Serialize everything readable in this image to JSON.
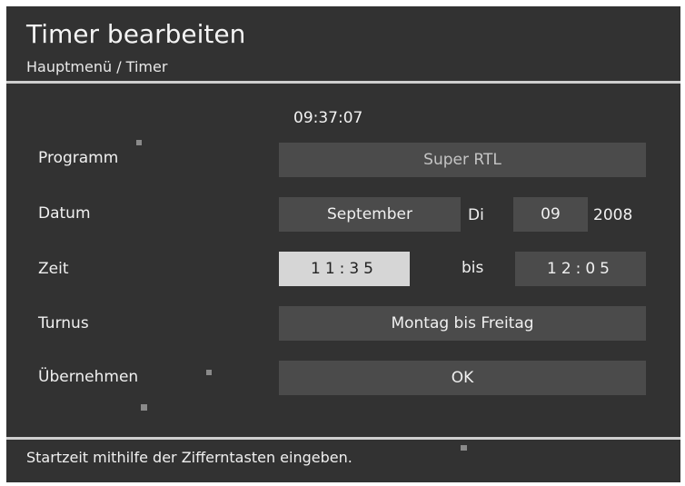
{
  "header": {
    "title": "Timer bearbeiten",
    "breadcrumb": "Hauptmenü / Timer"
  },
  "clock": "09:37:07",
  "form": {
    "programm": {
      "label": "Programm",
      "value": "Super RTL"
    },
    "datum": {
      "label": "Datum",
      "month": "September",
      "weekday": "Di",
      "day": "09",
      "year": "2008"
    },
    "zeit": {
      "label": "Zeit",
      "start": "11:35",
      "separator": "bis",
      "end": "12:05"
    },
    "turnus": {
      "label": "Turnus",
      "value": "Montag bis Freitag"
    },
    "uebernehmen": {
      "label": "Übernehmen",
      "value": "OK"
    }
  },
  "footer": {
    "hint": "Startzeit mithilfe der Zifferntasten eingeben."
  },
  "colors": {
    "background": "#323232",
    "field": "#4b4b4b",
    "active_field": "#d6d6d6",
    "text": "#f0f0f0"
  }
}
